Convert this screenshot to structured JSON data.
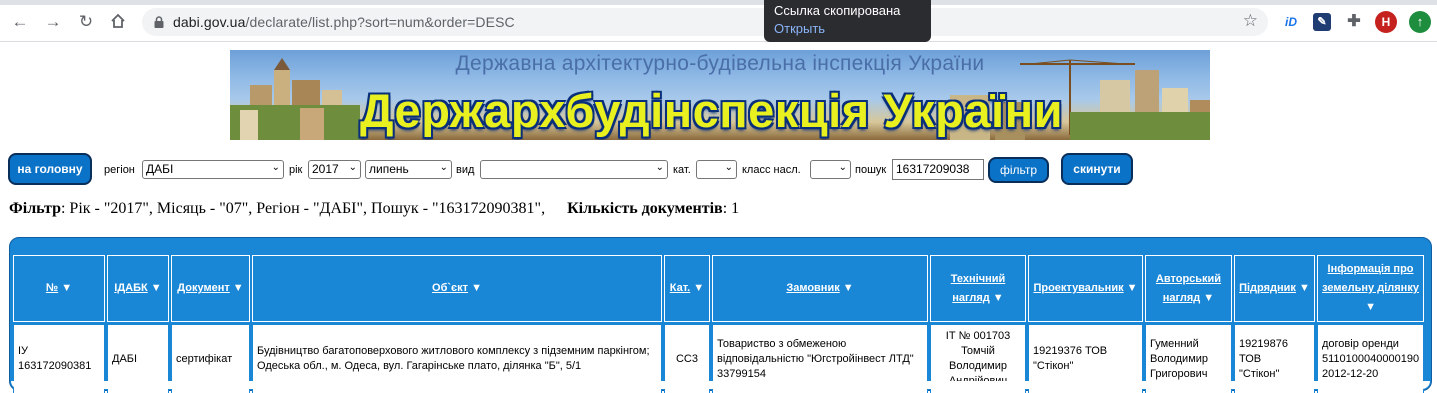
{
  "browser": {
    "url_host": "dabi.gov.ua",
    "url_path": "/declarate/list.php?sort=num&order=DESC",
    "toast_title": "Ссылка скопирована",
    "toast_action": "Открыть",
    "profile_initial": "H",
    "ext_id_label": "iD"
  },
  "banner": {
    "subtitle": "Державна архітектурно-будівельна інспекція України",
    "title": "Держархбудінспекція України"
  },
  "filters": {
    "home_button": "на головну",
    "region_label": "регіон",
    "region_value": "ДАБІ",
    "year_label": "рік",
    "year_value": "2017",
    "month_value": "липень",
    "type_label": "вид",
    "type_value": "",
    "cat_label": "кат.",
    "cat_value": "",
    "class_label": "класс насл.",
    "class_value": "",
    "search_label": "пошук",
    "search_value": "16317209038",
    "filter_button": "фільтр",
    "reset_button": "скинути"
  },
  "summary": {
    "filter_label": "Фільтр",
    "filter_text": ": Рік - \"2017\", Місяць - \"07\", Регіон - \"ДАБІ\", Пошук - \"163172090381\",",
    "count_label": "Кількість документів",
    "count_value": ": 1"
  },
  "table": {
    "headers": {
      "num": "№",
      "idabk": "ІДАБК",
      "doc": "Документ",
      "object": "Об`єкт",
      "cat": "Кат.",
      "customer": "Замовник",
      "tech_l1": "Технічний",
      "tech_l2": "нагляд",
      "designer": "Проектувальник",
      "author_l1": "Авторський",
      "author_l2": "нагляд",
      "contractor": "Підрядник",
      "land_l1": "Інформація про",
      "land_l2": "земельну ділянку"
    },
    "row": {
      "num_l1": "ІУ",
      "num_l2": "163172090381",
      "idabk": "ДАБІ",
      "doc": "сертифікат",
      "object": "Будівництво багатоповерхового житлового комплексу з підземним паркінгом; Одеська обл., м. Одеса, вул. Гагарінське плато, ділянка \"Б\", 5/1",
      "cat": "СС3",
      "customer": "Товариство з обмеженою відповідальністю \"Югстройінвест ЛТД\" 33799154",
      "tech_l1": "ІТ № 001703",
      "tech_l2": "Томчій",
      "tech_l3": "Володимир",
      "tech_l4": "Андрійович",
      "designer": "19219376 ТОВ \"Стікон\"",
      "author_l1": "Гуменний",
      "author_l2": "Володимир",
      "author_l3": "Григорович",
      "contractor_l1": "19219876",
      "contractor_l2": "ТОВ",
      "contractor_l3": "\"Стікон\"",
      "land_l1": "договір оренди",
      "land_l2": "5110100040000190",
      "land_l3": "2012-12-20"
    }
  },
  "colors": {
    "accent": "#1a86d6",
    "button": "#0a72c7",
    "banner_title": "#e8f020"
  }
}
